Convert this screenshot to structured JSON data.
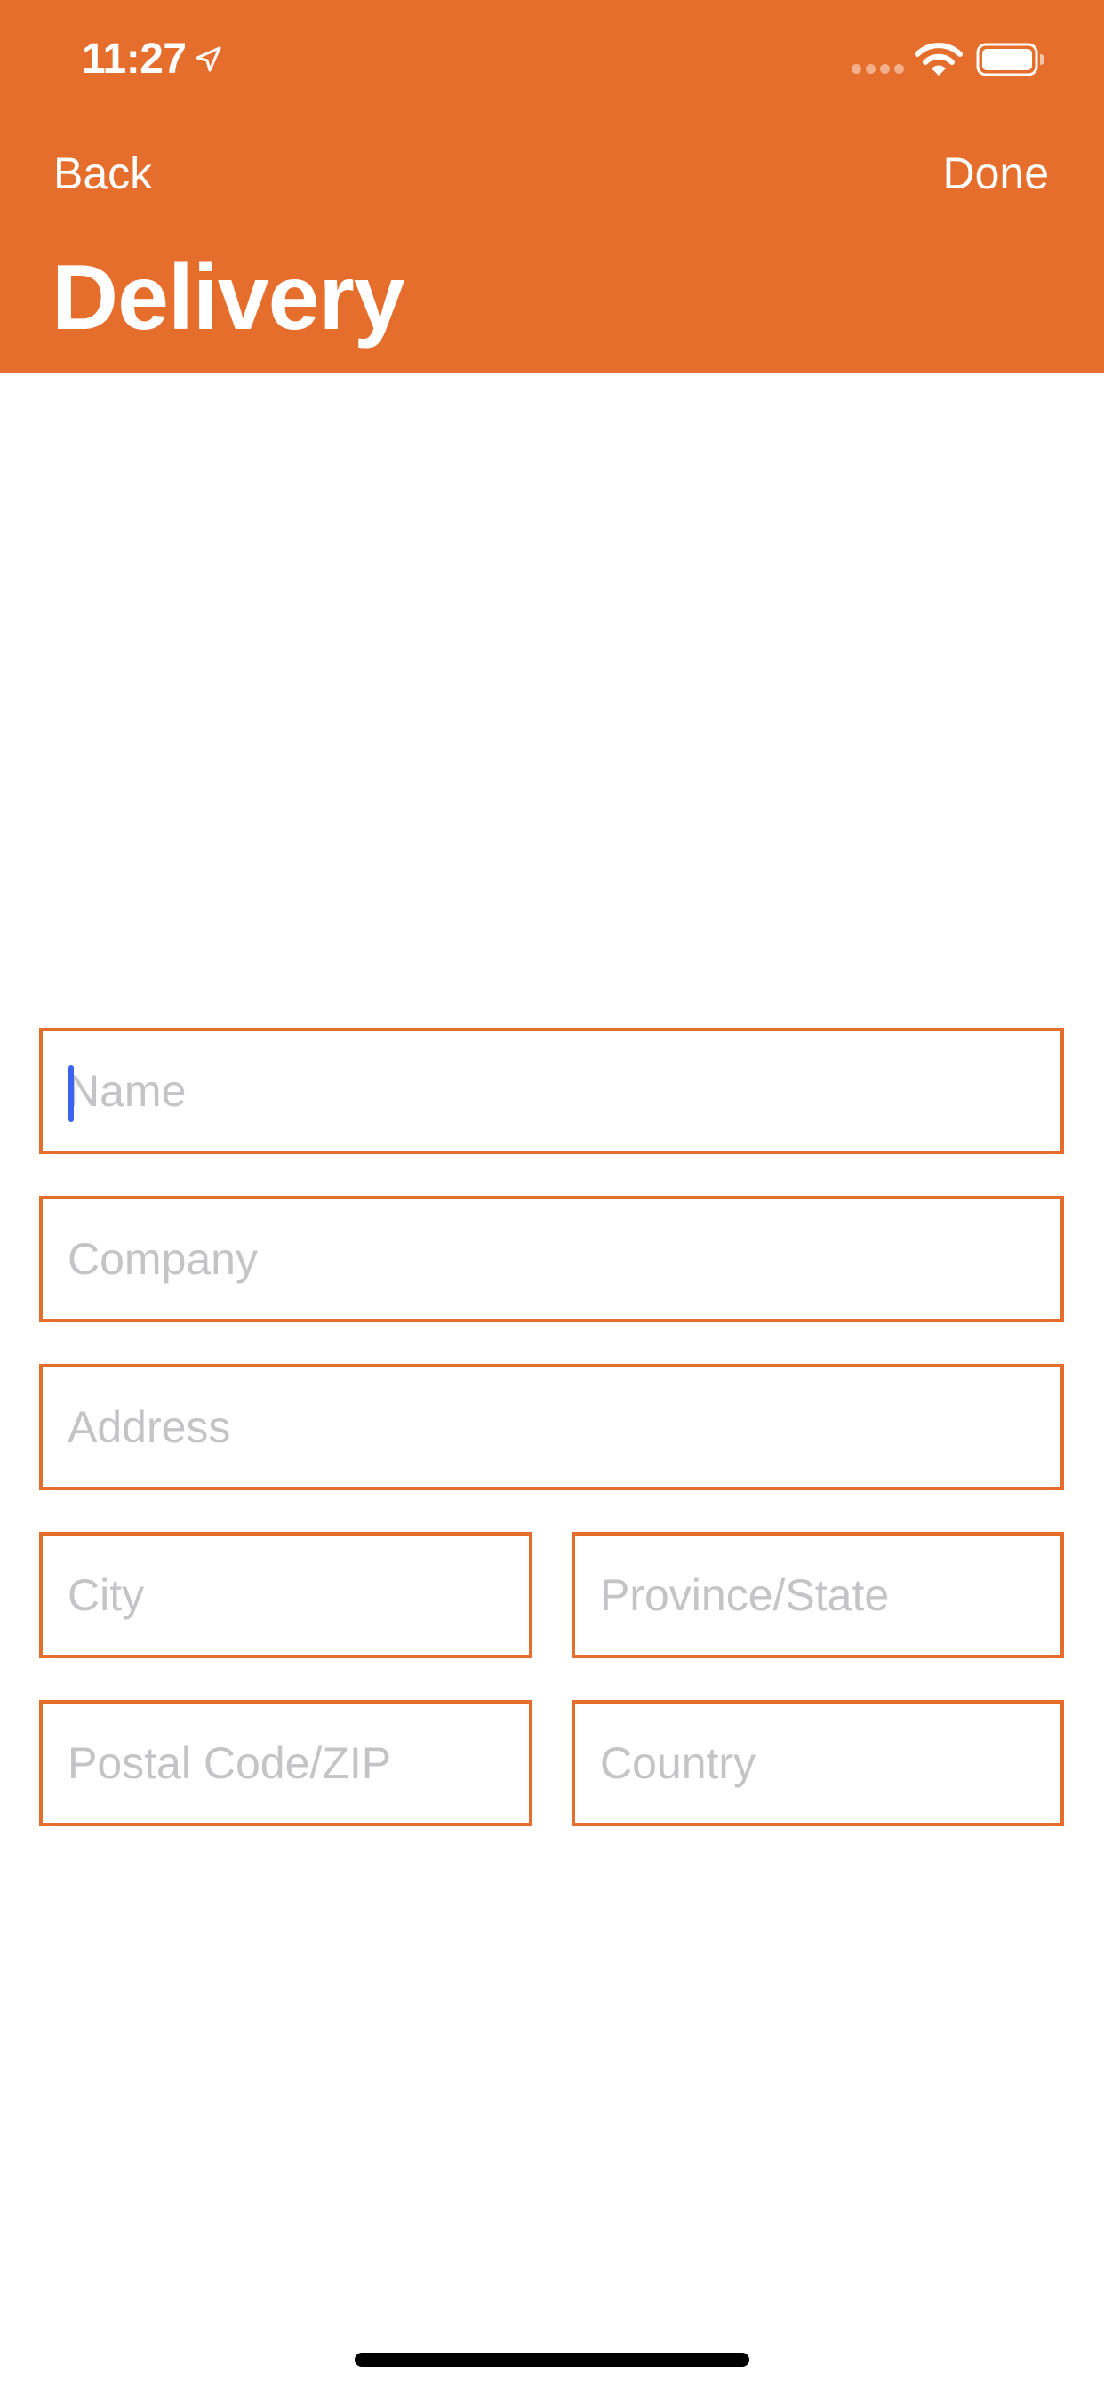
{
  "status_bar": {
    "time": "11:27",
    "icons": [
      "location-arrow-icon",
      "signal-icon",
      "wifi-icon",
      "battery-icon"
    ]
  },
  "nav": {
    "back_label": "Back",
    "done_label": "Done",
    "title": "Delivery"
  },
  "form": {
    "name": {
      "placeholder": "Name",
      "value": ""
    },
    "company": {
      "placeholder": "Company",
      "value": ""
    },
    "address": {
      "placeholder": "Address",
      "value": ""
    },
    "city": {
      "placeholder": "City",
      "value": ""
    },
    "province": {
      "placeholder": "Province/State",
      "value": ""
    },
    "postal": {
      "placeholder": "Postal Code/ZIP",
      "value": ""
    },
    "country": {
      "placeholder": "Country",
      "value": ""
    },
    "focused_field": "name"
  },
  "colors": {
    "brand": "#E56E2D",
    "placeholder": "#C4C4C6",
    "caret": "#3C63F0"
  }
}
